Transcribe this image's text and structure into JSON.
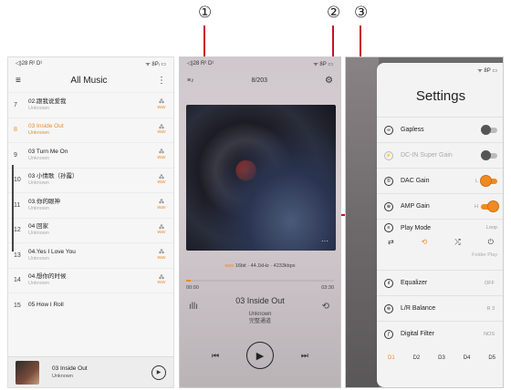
{
  "callouts": [
    "①",
    "②",
    "③"
  ],
  "library": {
    "status_left": "◁)28 R² D¹",
    "status_right": "ᯤ 8Pᵢ ▭",
    "menu_icon": "≡",
    "title": "All Music",
    "more_icon": "⋮",
    "tracks": [
      {
        "num": "7",
        "name": "02.跟我说爱我",
        "artist": "Unknown",
        "format": "wav"
      },
      {
        "num": "8",
        "name": "03 Inside Out",
        "artist": "Unknown",
        "format": "wav",
        "active": true
      },
      {
        "num": "9",
        "name": "03 Turn Me On",
        "artist": "Unknown",
        "format": "wav"
      },
      {
        "num": "10",
        "name": "03 小情歌（孙露）",
        "artist": "Unknown",
        "format": "wav"
      },
      {
        "num": "11",
        "name": "03.你的眼神",
        "artist": "Unknown",
        "format": "wav"
      },
      {
        "num": "12",
        "name": "04 回家",
        "artist": "Unknown",
        "format": "wav"
      },
      {
        "num": "13",
        "name": "04.Yes I Love You",
        "artist": "Unknown",
        "format": "wav"
      },
      {
        "num": "14",
        "name": "04.想你的时候",
        "artist": "Unknown",
        "format": "wav"
      },
      {
        "num": "15",
        "name": "05 How I Roll",
        "artist": "",
        "format": ""
      }
    ],
    "mini_player": {
      "title": "03 Inside Out",
      "artist": "Unknown",
      "play_icon": "▶"
    }
  },
  "player": {
    "status_left": "◁)28 R² D¹",
    "status_right": "ᯤ 8P ▭",
    "queue_icon": "≡♪",
    "counter": "8/203",
    "settings_icon": "⚙",
    "quality_format": "wav",
    "quality_text": "16bit · 44.1kHz · 4233kbps",
    "progress": 0.03,
    "time_current": "00:00",
    "time_total": "03:30",
    "title": "03 Inside Out",
    "artist": "Unknown",
    "album": "完整通道",
    "eq_icon": "ıllı",
    "repeat_icon": "⟲",
    "prev_icon": "⏮",
    "play_icon": "▶",
    "next_icon": "⏭",
    "more_icon": "···"
  },
  "settings": {
    "status_left": "◁)28 R² D¹",
    "status_right": "ᯤ 8P ▭",
    "title": "Settings",
    "gapless_label": "Gapless",
    "dcin_label": "DC-IN Super Gain",
    "dac_label": "DAC Gain",
    "dac_value": "L",
    "amp_label": "AMP Gain",
    "amp_value": "H",
    "playmode_label": "Play Mode",
    "playmode_value": "Loop",
    "playmode_folder": "Folder Play",
    "eq_label": "Equalizer",
    "eq_value": "OFF",
    "lr_label": "L/R Balance",
    "lr_value": "R 3",
    "filter_label": "Digital Filter",
    "filter_value": "NOS",
    "filters": [
      "D1",
      "D2",
      "D3",
      "D4",
      "D5"
    ],
    "accent": "#f08a24"
  }
}
